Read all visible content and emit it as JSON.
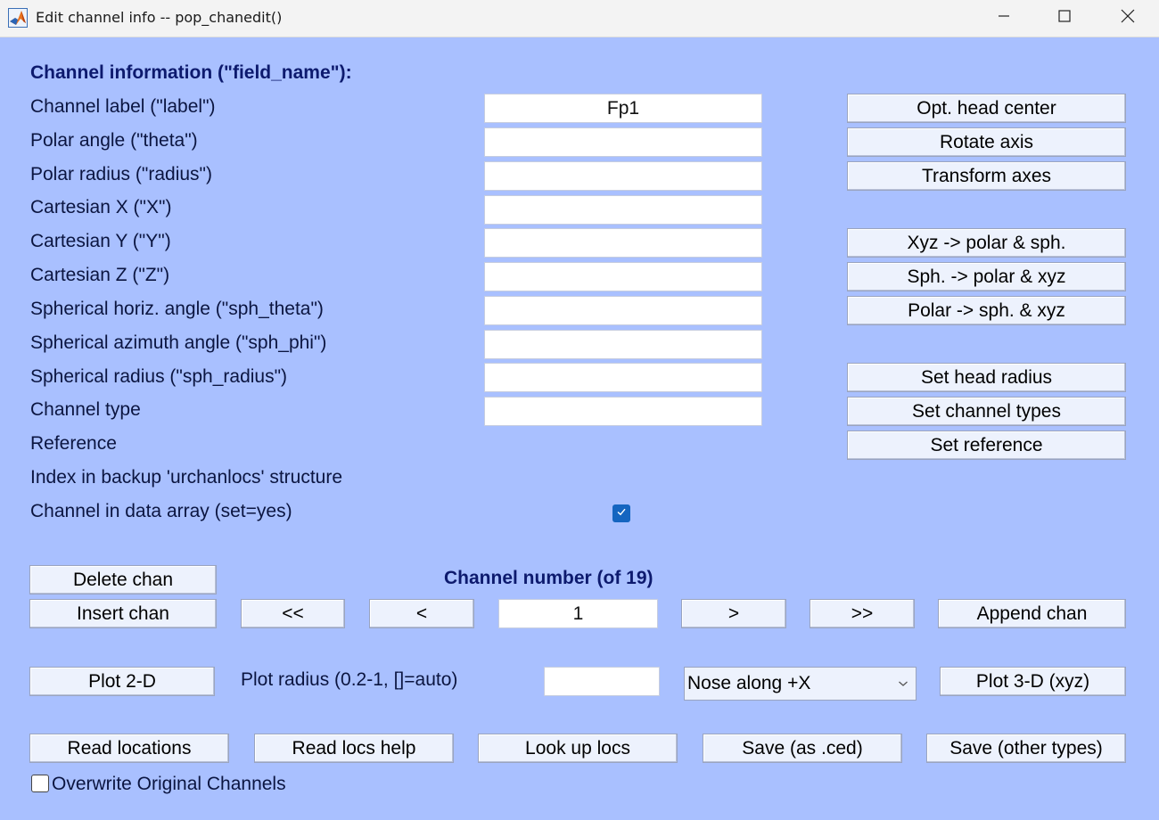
{
  "window": {
    "title": "Edit channel info -- pop_chanedit()",
    "app_icon": "matlab-icon",
    "controls": [
      "minimize-icon",
      "maximize-icon",
      "close-icon"
    ]
  },
  "form": {
    "header": "Channel information (\"field_name\"):",
    "fields": [
      {
        "label": "Channel label (\"label\")",
        "value": "Fp1"
      },
      {
        "label": "Polar angle (\"theta\")",
        "value": ""
      },
      {
        "label": "Polar radius (\"radius\")",
        "value": ""
      },
      {
        "label": "Cartesian X (\"X\")",
        "value": ""
      },
      {
        "label": "Cartesian Y (\"Y\")",
        "value": ""
      },
      {
        "label": "Cartesian Z (\"Z\")",
        "value": ""
      },
      {
        "label": "Spherical horiz. angle (\"sph_theta\")",
        "value": ""
      },
      {
        "label": "Spherical azimuth angle (\"sph_phi\")",
        "value": ""
      },
      {
        "label": "Spherical radius (\"sph_radius\")",
        "value": ""
      },
      {
        "label": "Channel type",
        "value": ""
      }
    ],
    "reference_label": "Reference",
    "index_label": "Index in backup 'urchanlocs' structure",
    "in_data_label": "Channel in data array (set=yes)",
    "in_data_checked": true
  },
  "side_buttons": {
    "opt_head_center": "Opt. head center",
    "rotate_axis": "Rotate axis",
    "transform_axes": "Transform axes",
    "xyz_to_polar": "Xyz -> polar & sph.",
    "sph_to_polar": "Sph. -> polar & xyz",
    "polar_to_sph": "Polar -> sph. & xyz",
    "set_head_radius": "Set head radius",
    "set_channel_types": "Set channel types",
    "set_reference": "Set reference"
  },
  "nav": {
    "delete_chan": "Delete chan",
    "insert_chan": "Insert chan",
    "channel_number_label": "Channel number (of 19)",
    "first": "<<",
    "prev": "<",
    "current": "1",
    "next": ">",
    "last": ">>",
    "append_chan": "Append chan"
  },
  "plot": {
    "plot_2d": "Plot 2-D",
    "radius_label": "Plot radius (0.2-1, []=auto)",
    "radius_value": "",
    "orientation": "Nose along +X",
    "plot_3d": "Plot 3-D (xyz)"
  },
  "bottom": {
    "read_locations": "Read locations",
    "read_locs_help": "Read locs help",
    "look_up_locs": "Look up locs",
    "save_ced": "Save (as .ced)",
    "save_other": "Save (other types)",
    "overwrite_label": "Overwrite Original Channels",
    "overwrite_checked": false
  },
  "colors": {
    "background": "#a9c0ff",
    "button": "#edf2fd",
    "checkbox_accent": "#1565c0",
    "bold_text": "#0d1a6e"
  }
}
